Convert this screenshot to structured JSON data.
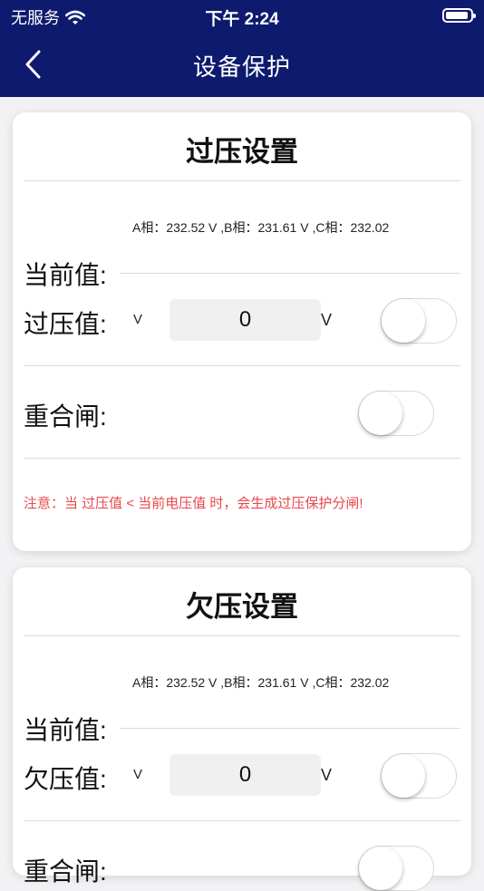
{
  "status_bar": {
    "carrier": "无服务",
    "time": "下午 2:24"
  },
  "nav": {
    "title": "设备保护"
  },
  "overvoltage": {
    "title": "过压设置",
    "phase_readings": "A相：232.52 V ,B相：231.61 V ,C相：232.02",
    "current_label": "当前值:",
    "value_label": "过压值:",
    "unit_small": "V",
    "value": "0",
    "unit": "V",
    "enabled": false,
    "reclose_label": "重合闸:",
    "reclose_enabled": false,
    "note": "注意：当 过压值 < 当前电压值 时，会生成过压保护分闸!"
  },
  "undervoltage": {
    "title": "欠压设置",
    "phase_readings": "A相：232.52 V ,B相：231.61 V ,C相：232.02",
    "current_label": "当前值:",
    "value_label": "欠压值:",
    "unit_small": "V",
    "value": "0",
    "unit": "V",
    "enabled": false,
    "reclose_label": "重合闸:",
    "reclose_enabled": false
  },
  "colors": {
    "nav_bg": "#0d1a6e",
    "note": "#e8474c"
  }
}
